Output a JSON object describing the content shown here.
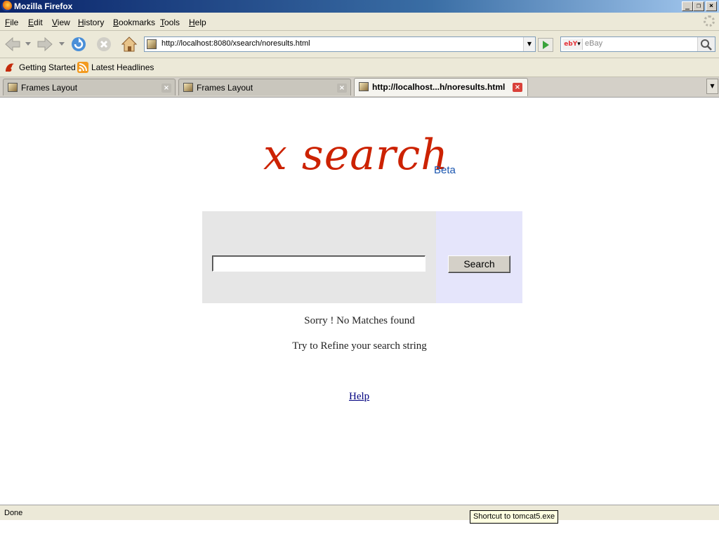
{
  "window": {
    "title": "Mozilla Firefox"
  },
  "menubar": {
    "items": [
      {
        "label": "File",
        "key": "F",
        "rest": "ile"
      },
      {
        "label": "Edit",
        "key": "E",
        "rest": "dit"
      },
      {
        "label": "View",
        "key": "V",
        "rest": "iew"
      },
      {
        "label": "History",
        "key": "H",
        "rest": "istory"
      },
      {
        "label": "Bookmarks",
        "key": "B",
        "rest": "ookmarks"
      },
      {
        "label": "Tools",
        "key": "T",
        "rest": "ools"
      },
      {
        "label": "Help",
        "key": "H",
        "rest": "elp"
      }
    ]
  },
  "navbar": {
    "url": "http://localhost:8080/xsearch/noresults.html",
    "search_engine": "ebY",
    "search_placeholder": "eBay"
  },
  "bookmarks": [
    {
      "label": "Getting Started",
      "icon": "firefox-icon"
    },
    {
      "label": "Latest Headlines",
      "icon": "rss-feed-icon"
    }
  ],
  "tabs": [
    {
      "label": "Frames Layout",
      "active": false
    },
    {
      "label": "Frames Layout",
      "active": false
    },
    {
      "label": "http://localhost...h/noresults.html",
      "active": true
    }
  ],
  "page": {
    "logo": "x search",
    "beta": "Beta",
    "search_value": "",
    "search_button": "Search",
    "message": "Sorry ! No Matches found",
    "hint": "Try to Refine your search string",
    "help_link": "Help"
  },
  "status": {
    "text": "Done",
    "tooltip": "Shortcut to tomcat5.exe"
  },
  "colors": {
    "logo": "#cc2200",
    "beta": "#1a56b0",
    "search_panel": "#e6e6e6",
    "button_panel": "#e5e5fb",
    "link": "#000080"
  }
}
